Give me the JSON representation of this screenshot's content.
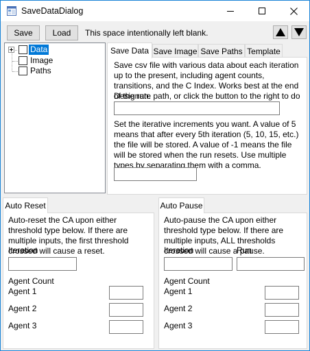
{
  "window": {
    "title": "SaveDataDialog",
    "icons": {
      "app": "app-icon",
      "minimize": "minimize-icon",
      "maximize": "maximize-icon",
      "close": "close-icon"
    }
  },
  "toolbar": {
    "save_label": "Save",
    "load_label": "Load",
    "info_text": "This space intentionally left blank.",
    "up_icon": "arrow-up-icon",
    "down_icon": "arrow-down-icon"
  },
  "tree": {
    "nodes": [
      {
        "label": "Data",
        "selected": true,
        "expandable": true
      },
      {
        "label": "Image",
        "selected": false,
        "expandable": false
      },
      {
        "label": "Paths",
        "selected": false,
        "expandable": false
      }
    ]
  },
  "top_tabs": {
    "labels": [
      "Save Data",
      "Save Image",
      "Save Paths",
      "Template"
    ],
    "active": "Save Data"
  },
  "save_data_panel": {
    "description": "Save csv file with various data about each iteration up to the present, including agent counts, transitions, and the C Index. Works best at the end of the run.",
    "path_prompt": "Designate path, or click the button to the right to do so.",
    "path_value": "",
    "increment_help": "Set the iterative increments you want. A value of 5 means that after every 5th iteration (5, 10, 15, etc.) the file will be stored. A value of -1 means the file will be stored when the run resets. Use multiple types by separating them with a comma.",
    "increment_value": ""
  },
  "auto_reset": {
    "tab_label": "Auto Reset",
    "description": "Auto-reset the CA upon either threshold type below. If there are multiple inputs, the first threshold crossed will cause a reset.",
    "iteration_label": "Iteration",
    "iteration_value": "",
    "agent_count_label": "Agent Count",
    "agents": [
      {
        "label": "Agent 1",
        "value": ""
      },
      {
        "label": "Agent 2",
        "value": ""
      },
      {
        "label": "Agent 3",
        "value": ""
      }
    ]
  },
  "auto_pause": {
    "tab_label": "Auto Pause",
    "description": "Auto-pause the CA upon either threshold type below. If there are multiple inputs, ALL thresholds crossed will cause a pause.",
    "iteration_label": "Iteration",
    "iteration_value": "",
    "run_label": "Run",
    "run_value": "",
    "agent_count_label": "Agent Count",
    "agents": [
      {
        "label": "Agent 1",
        "value": ""
      },
      {
        "label": "Agent 2",
        "value": ""
      },
      {
        "label": "Agent 3",
        "value": ""
      }
    ]
  }
}
